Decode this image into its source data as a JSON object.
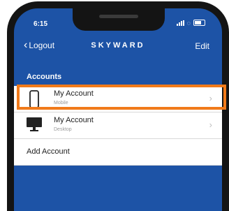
{
  "status_bar": {
    "time": "6:15"
  },
  "navbar": {
    "back_label": "Logout",
    "brand": "SKYWARD",
    "edit_label": "Edit"
  },
  "section": {
    "title": "Accounts"
  },
  "accounts": [
    {
      "title": "My Account",
      "subtitle": "Mobile",
      "icon": "phone-icon"
    },
    {
      "title": "My Account",
      "subtitle": "Desktop",
      "icon": "desktop-icon"
    }
  ],
  "add_account": {
    "label": "Add Account"
  },
  "colors": {
    "header_blue": "#1d53a6",
    "highlight_orange": "#f17a1a"
  }
}
